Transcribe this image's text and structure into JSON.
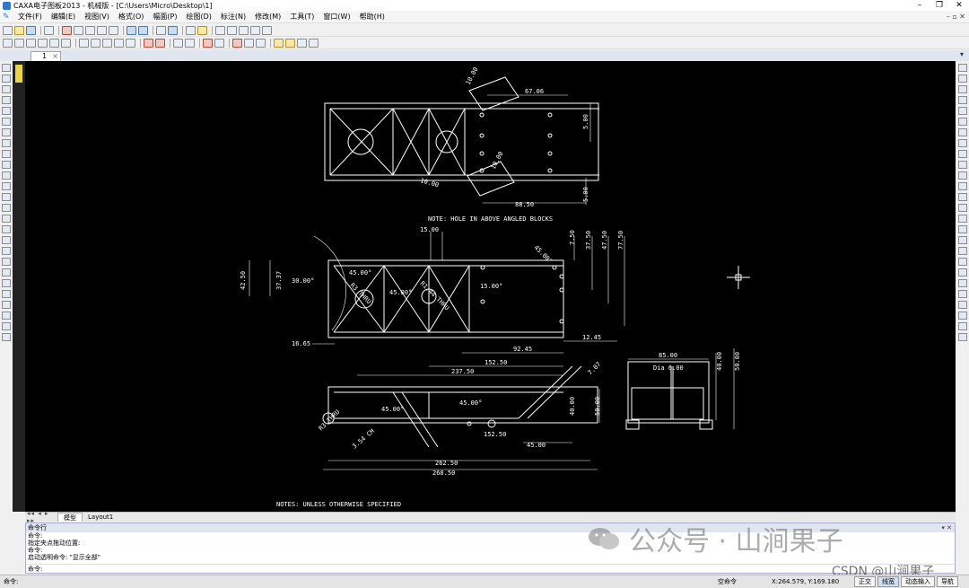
{
  "window": {
    "title": "CAXA电子图板2013 - 机械版 - [C:\\Users\\Micro\\Desktop\\1]",
    "controls": [
      "–",
      "❐",
      "✕"
    ]
  },
  "menu": {
    "items": [
      "文件(F)",
      "编辑(E)",
      "视图(V)",
      "格式(O)",
      "幅面(P)",
      "绘图(D)",
      "标注(N)",
      "修改(M)",
      "工具(T)",
      "窗口(W)",
      "帮助(H)"
    ],
    "mdi_controls": "– ▫ ✕"
  },
  "document_tab": {
    "label": "1",
    "close": "×",
    "overflow_arrow": "▾"
  },
  "drawing": {
    "note_top": "NOTE: HOLE IN ABOVE ANGLED BLOCKS",
    "note_bottom": "NOTES: UNLESS OTHERWISE SPECIFIED",
    "dims": {
      "d_10_00_a": "10.00",
      "d_67_06": "67.06",
      "d_5_00_a": "5.00",
      "d_10_00_b": "10.00",
      "d_10_00_c": "10.00",
      "d_88_50": "88.50",
      "d_5_00_b": "5.00",
      "d_15_00": "15.00",
      "d_7_50": "7.50",
      "d_37_50": "37.50",
      "d_47_50": "47.50",
      "d_77_50": "77.50",
      "d_42_50": "42.50",
      "d_37_37": "37.37",
      "d_30_00_ang": "30.00°",
      "d_45_00_ang_a": "45.00°",
      "d_45_00_ang_b": "45.00°",
      "d_45_00_ang_c": "45.00°",
      "d_15_00_ang": "15.00°",
      "d_r_thru_a": "R3 THRU",
      "d_r_thru_b": "R1.44 THRU",
      "d_16_65": "16.65",
      "d_92_45": "92.45",
      "d_12_45": "12.45",
      "d_152_50_a": "152.50",
      "d_237_50": "237.50",
      "d_7_07": "7.07",
      "d_85_00": "85.00",
      "d_dia_6": "Dia 6.00",
      "d_40_00_a": "40.00",
      "d_50_00_a": "50.00",
      "d_45_00_ang_d": "45.00°",
      "d_45_00_ang_e": "45.00°",
      "d_40_00_b": "40.00",
      "d_50_00_b": "50.00",
      "d_152_50_b": "152.50",
      "d_45_00": "45.00",
      "d_3_54": "3.54 CM",
      "d_r_thru_c": "R3 THRU",
      "d_262_50": "262.50",
      "d_268_50": "268.50"
    }
  },
  "layout_tabs": {
    "nav": "◂◂ ◂ ▸ ▸▸",
    "model": "模型",
    "layout1": "Layout1"
  },
  "command": {
    "header": "命令行",
    "header_controls": "▾ ✕",
    "history": [
      "命令:",
      "指定夹点拖动位置:",
      "命令:",
      "启动透明命令: \"显示全部\""
    ],
    "prompt": "命令:",
    "input_value": ""
  },
  "status": {
    "left": "命令:",
    "cmd_state": "空命令",
    "coords": "X:264.579, Y:169.180",
    "modes": [
      "正交",
      "线宽",
      "动态输入",
      "导航"
    ],
    "active_modes": [
      1
    ]
  },
  "watermark": {
    "text": "公众号 · 山涧果子",
    "csdn": "CSDN @山涧果子"
  }
}
